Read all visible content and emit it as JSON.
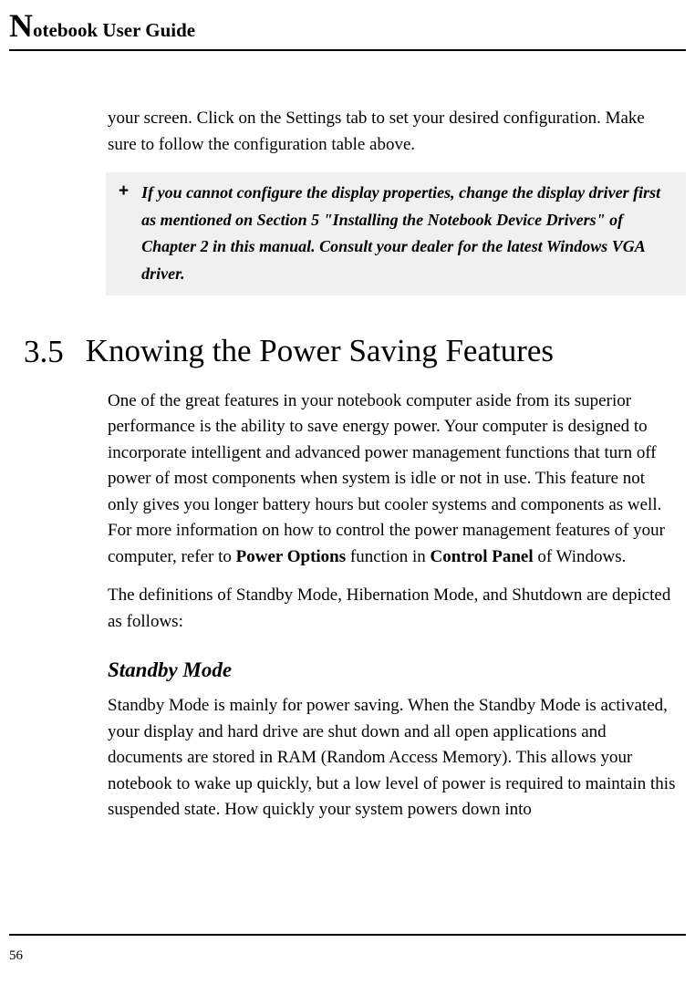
{
  "header": {
    "drop_cap": "N",
    "title_rest": "otebook User Guide"
  },
  "continuation": "your screen. Click on the Settings tab to set your desired configuration. Make sure to follow the configuration table above.",
  "note": {
    "marker": "+",
    "text": "If you cannot configure the display properties, change the display driver first as mentioned on Section 5 \"Installing the Notebook Device Drivers\" of Chapter 2 in this manual. Consult your dealer for the latest Windows VGA driver."
  },
  "section": {
    "number": "3.5",
    "title": "Knowing the Power Saving Features"
  },
  "paragraphs": {
    "p1_a": "One of the great features in your notebook computer aside from its superior performance is the ability to save energy power. Your computer is designed to incorporate intelligent and advanced power management functions that turn off power of most components when system is idle or not in use. This feature not only gives you longer battery hours but cooler systems and components as well. For more information on how to control the power management features of your computer, refer to ",
    "p1_bold1": "Power Options",
    "p1_b": " function in ",
    "p1_bold2": "Control Panel",
    "p1_c": " of Windows.",
    "p2": "The definitions of Standby Mode, Hibernation Mode, and Shutdown are depicted as follows:"
  },
  "subsection": {
    "title": "Standby Mode",
    "body": "Standby Mode is mainly for power saving. When the Standby Mode is activated, your display and hard drive are shut down and all open applications and documents are stored in RAM (Random Access Memory). This allows your notebook to wake up quickly, but a low level of power is required to maintain this suspended state. How quickly your system powers down into"
  },
  "page_number": "56"
}
